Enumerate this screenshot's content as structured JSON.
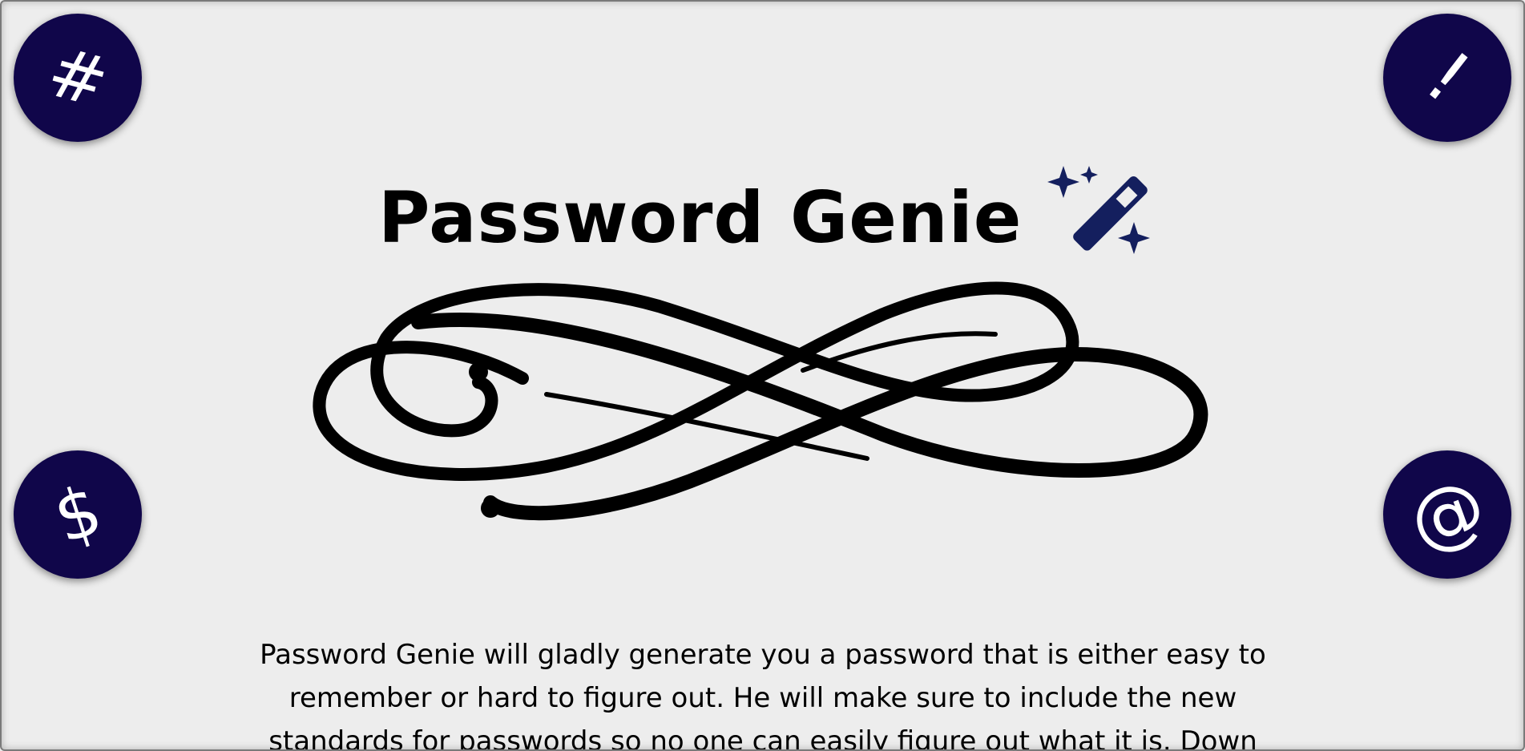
{
  "buttons": {
    "hash": "#",
    "exclamation": "!",
    "dollar": "$",
    "at": "@"
  },
  "header": {
    "title": "Password Genie"
  },
  "icons": {
    "wand": "magic-wand-sparkles-icon",
    "flourish": "infinity-flourish-ornament"
  },
  "main": {
    "description": "Password Genie will gladly generate you a password that is either easy to remember or hard to figure out. He will make sure to include the new standards for passwords so no one can easily figure out what it is. Down"
  },
  "colors": {
    "button_bg": "#10064a",
    "wand": "#141f5e",
    "background": "#ededed"
  }
}
